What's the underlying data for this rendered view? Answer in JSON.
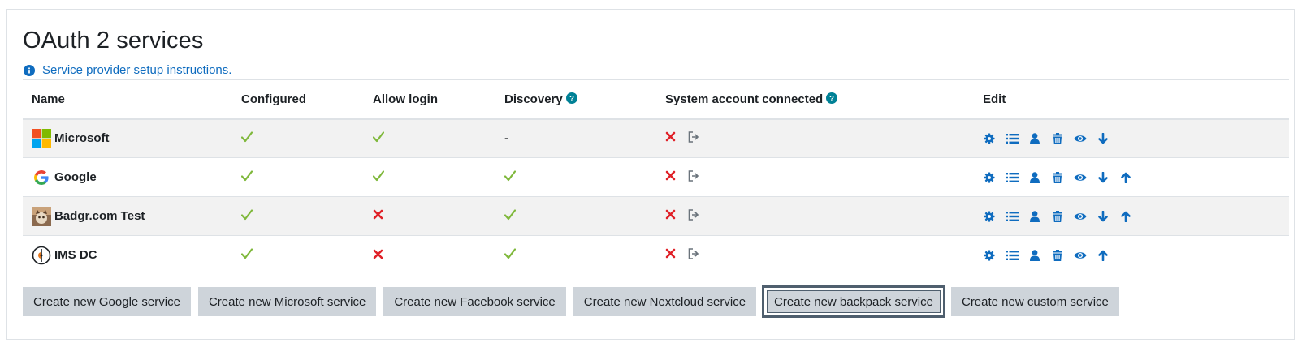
{
  "page": {
    "title": "OAuth 2 services",
    "help_link": "Service provider setup instructions."
  },
  "colors": {
    "link": "#0f6cbf",
    "check": "#7fb83b",
    "cross": "#e02027",
    "muted": "#6a737b"
  },
  "table": {
    "headers": {
      "name": "Name",
      "configured": "Configured",
      "allow_login": "Allow login",
      "discovery": "Discovery",
      "system_account": "System account connected",
      "edit": "Edit"
    },
    "rows": [
      {
        "name": "Microsoft",
        "logo": "microsoft-logo",
        "configured": "yes",
        "allow_login": "yes",
        "discovery": "-",
        "system_account": "no",
        "edit_icons": [
          "gear-icon",
          "list-icon",
          "user-icon",
          "trash-icon",
          "eye-icon",
          "arrow-down-icon"
        ]
      },
      {
        "name": "Google",
        "logo": "google-logo",
        "configured": "yes",
        "allow_login": "yes",
        "discovery": "yes",
        "system_account": "no",
        "edit_icons": [
          "gear-icon",
          "list-icon",
          "user-icon",
          "trash-icon",
          "eye-icon",
          "arrow-down-icon",
          "arrow-up-icon"
        ]
      },
      {
        "name": "Badgr.com Test",
        "logo": "badgr-logo",
        "configured": "yes",
        "allow_login": "no",
        "discovery": "yes",
        "system_account": "no",
        "edit_icons": [
          "gear-icon",
          "list-icon",
          "user-icon",
          "trash-icon",
          "eye-icon",
          "arrow-down-icon",
          "arrow-up-icon"
        ]
      },
      {
        "name": "IMS DC",
        "logo": "ims-logo",
        "configured": "yes",
        "allow_login": "no",
        "discovery": "yes",
        "system_account": "no",
        "edit_icons": [
          "gear-icon",
          "list-icon",
          "user-icon",
          "trash-icon",
          "eye-icon",
          "arrow-up-icon"
        ]
      }
    ]
  },
  "buttons": [
    "Create new Google service",
    "Create new Microsoft service",
    "Create new Facebook service",
    "Create new Nextcloud service",
    "Create new backpack service",
    "Create new custom service"
  ]
}
